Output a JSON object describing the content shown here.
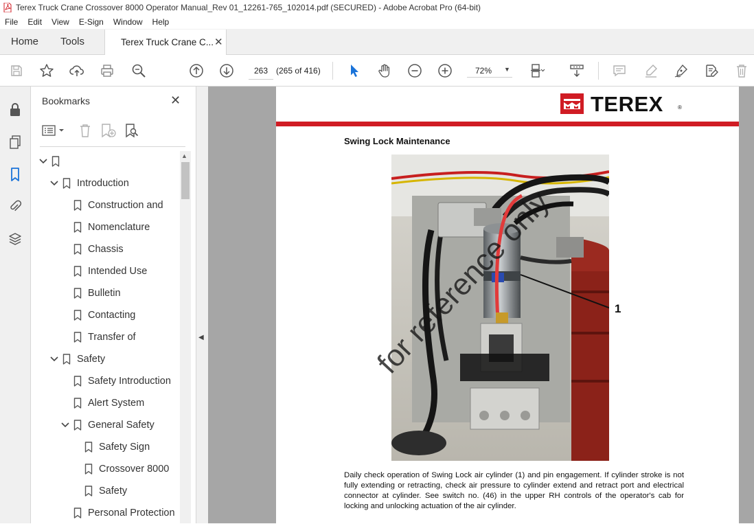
{
  "window": {
    "title": "Terex Truck Crane Crossover 8000 Operator Manual_Rev 01_12261-765_102014.pdf (SECURED) - Adobe Acrobat Pro (64-bit)"
  },
  "menu": [
    "File",
    "Edit",
    "View",
    "E-Sign",
    "Window",
    "Help"
  ],
  "tabs": {
    "home": "Home",
    "tools": "Tools",
    "document": "Terex Truck Crane C...",
    "close_glyph": "✕"
  },
  "toolbar": {
    "page_number": "263",
    "page_count": "(265 of 416)",
    "zoom": "72%"
  },
  "bookmarks": {
    "title": "Bookmarks",
    "close_glyph": "✕",
    "items": [
      {
        "label": "",
        "level": 0,
        "expanded": true
      },
      {
        "label": "Introduction",
        "level": 1,
        "expanded": true
      },
      {
        "label": "Construction and",
        "level": 2
      },
      {
        "label": "Nomenclature",
        "level": 2
      },
      {
        "label": "Chassis",
        "level": 2
      },
      {
        "label": "Intended Use",
        "level": 2
      },
      {
        "label": "Bulletin",
        "level": 2
      },
      {
        "label": "Contacting",
        "level": 2
      },
      {
        "label": "Transfer of",
        "level": 2
      },
      {
        "label": "Safety",
        "level": 1,
        "expanded": true
      },
      {
        "label": "Safety Introduction",
        "level": 2
      },
      {
        "label": "Alert System",
        "level": 2
      },
      {
        "label": "General Safety",
        "level": 2,
        "expanded": true
      },
      {
        "label": "Safety Sign",
        "level": 3
      },
      {
        "label": "Crossover 8000",
        "level": 3
      },
      {
        "label": "Safety",
        "level": 3
      },
      {
        "label": "Personal Protection",
        "level": 2
      }
    ]
  },
  "document": {
    "brand": "TEREX",
    "brand_mark": "®",
    "section_title": "Swing Lock Maintenance",
    "callout": "1",
    "body": "Daily check operation of Swing Lock air cylinder (1) and pin engagement. If cylinder stroke is not fully extending or retracting, check air pressure to cylinder extend and retract port and electrical connector at cylinder. See switch no. (46) in the upper RH controls of the operator's cab for locking and unlocking actuation of the air cylinder.",
    "watermark": "for reference only"
  },
  "colors": {
    "accent_blue": "#1a73d9",
    "brand_red": "#d01c24",
    "doc_background": "#a6a6a6"
  }
}
